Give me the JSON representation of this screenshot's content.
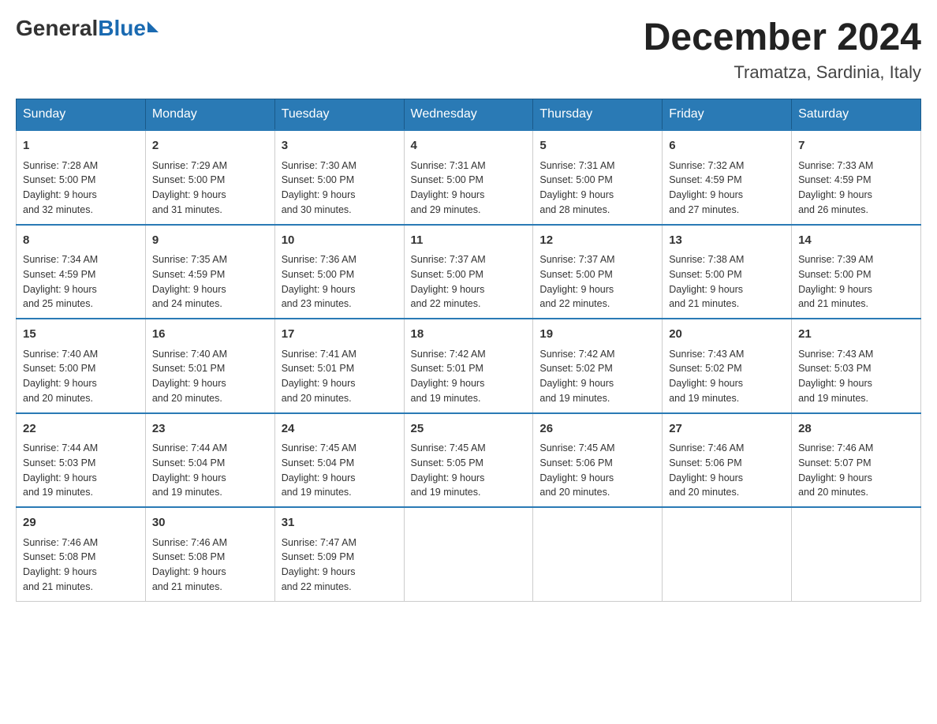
{
  "logo": {
    "general": "General",
    "blue": "Blue"
  },
  "title": "December 2024",
  "location": "Tramatza, Sardinia, Italy",
  "days_of_week": [
    "Sunday",
    "Monday",
    "Tuesday",
    "Wednesday",
    "Thursday",
    "Friday",
    "Saturday"
  ],
  "weeks": [
    [
      {
        "day": "1",
        "sunrise": "7:28 AM",
        "sunset": "5:00 PM",
        "daylight": "9 hours and 32 minutes."
      },
      {
        "day": "2",
        "sunrise": "7:29 AM",
        "sunset": "5:00 PM",
        "daylight": "9 hours and 31 minutes."
      },
      {
        "day": "3",
        "sunrise": "7:30 AM",
        "sunset": "5:00 PM",
        "daylight": "9 hours and 30 minutes."
      },
      {
        "day": "4",
        "sunrise": "7:31 AM",
        "sunset": "5:00 PM",
        "daylight": "9 hours and 29 minutes."
      },
      {
        "day": "5",
        "sunrise": "7:31 AM",
        "sunset": "5:00 PM",
        "daylight": "9 hours and 28 minutes."
      },
      {
        "day": "6",
        "sunrise": "7:32 AM",
        "sunset": "4:59 PM",
        "daylight": "9 hours and 27 minutes."
      },
      {
        "day": "7",
        "sunrise": "7:33 AM",
        "sunset": "4:59 PM",
        "daylight": "9 hours and 26 minutes."
      }
    ],
    [
      {
        "day": "8",
        "sunrise": "7:34 AM",
        "sunset": "4:59 PM",
        "daylight": "9 hours and 25 minutes."
      },
      {
        "day": "9",
        "sunrise": "7:35 AM",
        "sunset": "4:59 PM",
        "daylight": "9 hours and 24 minutes."
      },
      {
        "day": "10",
        "sunrise": "7:36 AM",
        "sunset": "5:00 PM",
        "daylight": "9 hours and 23 minutes."
      },
      {
        "day": "11",
        "sunrise": "7:37 AM",
        "sunset": "5:00 PM",
        "daylight": "9 hours and 22 minutes."
      },
      {
        "day": "12",
        "sunrise": "7:37 AM",
        "sunset": "5:00 PM",
        "daylight": "9 hours and 22 minutes."
      },
      {
        "day": "13",
        "sunrise": "7:38 AM",
        "sunset": "5:00 PM",
        "daylight": "9 hours and 21 minutes."
      },
      {
        "day": "14",
        "sunrise": "7:39 AM",
        "sunset": "5:00 PM",
        "daylight": "9 hours and 21 minutes."
      }
    ],
    [
      {
        "day": "15",
        "sunrise": "7:40 AM",
        "sunset": "5:00 PM",
        "daylight": "9 hours and 20 minutes."
      },
      {
        "day": "16",
        "sunrise": "7:40 AM",
        "sunset": "5:01 PM",
        "daylight": "9 hours and 20 minutes."
      },
      {
        "day": "17",
        "sunrise": "7:41 AM",
        "sunset": "5:01 PM",
        "daylight": "9 hours and 20 minutes."
      },
      {
        "day": "18",
        "sunrise": "7:42 AM",
        "sunset": "5:01 PM",
        "daylight": "9 hours and 19 minutes."
      },
      {
        "day": "19",
        "sunrise": "7:42 AM",
        "sunset": "5:02 PM",
        "daylight": "9 hours and 19 minutes."
      },
      {
        "day": "20",
        "sunrise": "7:43 AM",
        "sunset": "5:02 PM",
        "daylight": "9 hours and 19 minutes."
      },
      {
        "day": "21",
        "sunrise": "7:43 AM",
        "sunset": "5:03 PM",
        "daylight": "9 hours and 19 minutes."
      }
    ],
    [
      {
        "day": "22",
        "sunrise": "7:44 AM",
        "sunset": "5:03 PM",
        "daylight": "9 hours and 19 minutes."
      },
      {
        "day": "23",
        "sunrise": "7:44 AM",
        "sunset": "5:04 PM",
        "daylight": "9 hours and 19 minutes."
      },
      {
        "day": "24",
        "sunrise": "7:45 AM",
        "sunset": "5:04 PM",
        "daylight": "9 hours and 19 minutes."
      },
      {
        "day": "25",
        "sunrise": "7:45 AM",
        "sunset": "5:05 PM",
        "daylight": "9 hours and 19 minutes."
      },
      {
        "day": "26",
        "sunrise": "7:45 AM",
        "sunset": "5:06 PM",
        "daylight": "9 hours and 20 minutes."
      },
      {
        "day": "27",
        "sunrise": "7:46 AM",
        "sunset": "5:06 PM",
        "daylight": "9 hours and 20 minutes."
      },
      {
        "day": "28",
        "sunrise": "7:46 AM",
        "sunset": "5:07 PM",
        "daylight": "9 hours and 20 minutes."
      }
    ],
    [
      {
        "day": "29",
        "sunrise": "7:46 AM",
        "sunset": "5:08 PM",
        "daylight": "9 hours and 21 minutes."
      },
      {
        "day": "30",
        "sunrise": "7:46 AM",
        "sunset": "5:08 PM",
        "daylight": "9 hours and 21 minutes."
      },
      {
        "day": "31",
        "sunrise": "7:47 AM",
        "sunset": "5:09 PM",
        "daylight": "9 hours and 22 minutes."
      },
      null,
      null,
      null,
      null
    ]
  ],
  "labels": {
    "sunrise": "Sunrise: ",
    "sunset": "Sunset: ",
    "daylight": "Daylight: "
  }
}
